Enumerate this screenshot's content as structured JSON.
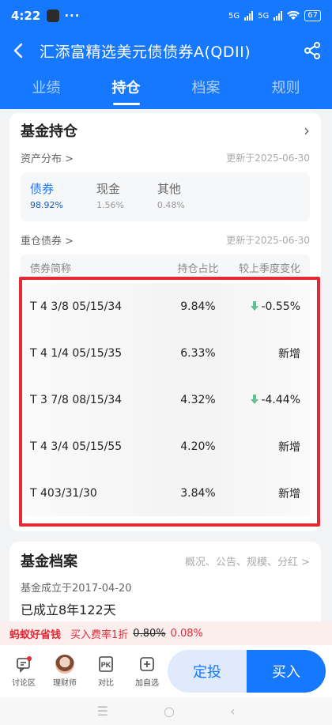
{
  "status": {
    "time": "4:22",
    "dots": "···",
    "sig1": "5G",
    "sig2": "5G",
    "battery": "67"
  },
  "header": {
    "title": "汇添富精选美元债债券A(QDII)"
  },
  "tabs": [
    {
      "label": "业绩",
      "active": false
    },
    {
      "label": "持仓",
      "active": true
    },
    {
      "label": "档案",
      "active": false
    },
    {
      "label": "规则",
      "active": false
    }
  ],
  "holdings": {
    "title": "基金持仓",
    "asset_label": "资产分布 >",
    "asset_updated": "更新于2025-06-30",
    "assets": [
      {
        "name": "债券",
        "value": "98.92%"
      },
      {
        "name": "现金",
        "value": "1.56%"
      },
      {
        "name": "其他",
        "value": "0.48%"
      }
    ],
    "bonds_label": "重仓债券 >",
    "bonds_updated": "更新于2025-06-30",
    "columns": {
      "name": "债券简称",
      "ratio": "持仓占比",
      "change": "较上季度变化"
    },
    "rows": [
      {
        "name": "T 4 3/8 05/15/34",
        "ratio": "9.84%",
        "change": "-0.55%",
        "down": true
      },
      {
        "name": "T 4 1/4 05/15/35",
        "ratio": "6.33%",
        "change": "新增",
        "down": false
      },
      {
        "name": "T 3 7/8 08/15/34",
        "ratio": "4.32%",
        "change": "-4.44%",
        "down": true
      },
      {
        "name": "T 4 3/4 05/15/55",
        "ratio": "4.20%",
        "change": "新增",
        "down": false
      },
      {
        "name": "T 403/31/30",
        "ratio": "3.84%",
        "change": "新增",
        "down": false
      }
    ]
  },
  "profile": {
    "title": "基金档案",
    "links": "概况、公告、规模、分红 >",
    "established": "基金成立于2017-04-20",
    "age": "已成立8年122天"
  },
  "promo": {
    "brand": "蚂蚁好省钱",
    "fee_label": "买入费率1折",
    "old_fee": "0.80%",
    "new_fee": "0.08%"
  },
  "bottom": {
    "items": [
      {
        "label": "讨论区"
      },
      {
        "label": "理财师"
      },
      {
        "label": "对比"
      },
      {
        "label": "加自选"
      }
    ],
    "sip": "定投",
    "buy": "买入"
  },
  "colors": {
    "primary": "#1677ff",
    "highlight": "#e32a36",
    "down": "#3bb27a"
  }
}
